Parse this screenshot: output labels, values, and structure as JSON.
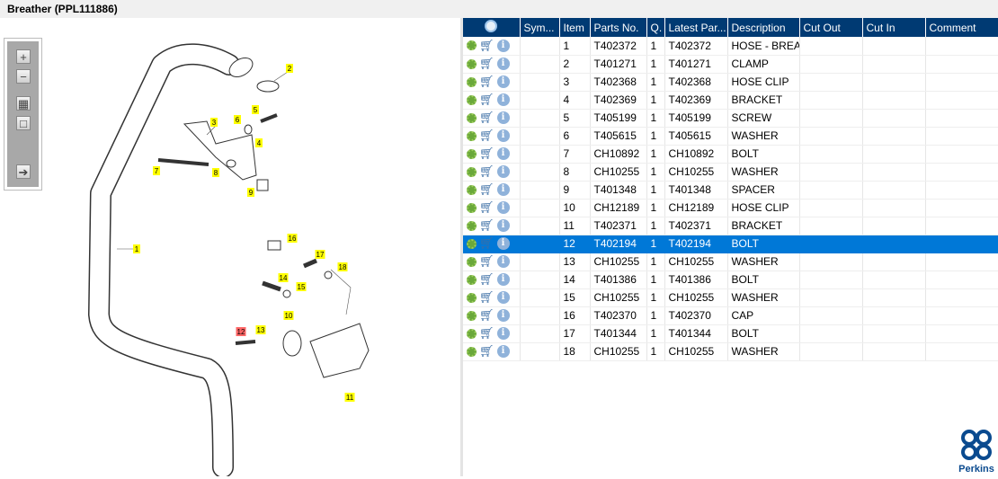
{
  "title": "Breather (PPL111886)",
  "toolbar": {
    "zoom_in": "zoom-in",
    "zoom_out": "zoom-out",
    "fit": "fit",
    "actual": "actual-size",
    "export": "export"
  },
  "diagram": {
    "callouts": [
      "1",
      "2",
      "3",
      "4",
      "5",
      "6",
      "7",
      "8",
      "9",
      "10",
      "11",
      "12",
      "13",
      "14",
      "15",
      "16",
      "17",
      "18"
    ],
    "highlighted": "12"
  },
  "table": {
    "columns": [
      "",
      "Sym...",
      "Item",
      "Parts No.",
      "Q.",
      "Latest Par...",
      "Description",
      "Cut Out",
      "Cut In",
      "Comment"
    ],
    "selected_item": "12",
    "rows": [
      {
        "item": "1",
        "part": "T402372",
        "qty": "1",
        "latest": "T402372",
        "desc": "HOSE - BREATHER"
      },
      {
        "item": "2",
        "part": "T401271",
        "qty": "1",
        "latest": "T401271",
        "desc": "CLAMP"
      },
      {
        "item": "3",
        "part": "T402368",
        "qty": "1",
        "latest": "T402368",
        "desc": "HOSE CLIP"
      },
      {
        "item": "4",
        "part": "T402369",
        "qty": "1",
        "latest": "T402369",
        "desc": "BRACKET"
      },
      {
        "item": "5",
        "part": "T405199",
        "qty": "1",
        "latest": "T405199",
        "desc": "SCREW"
      },
      {
        "item": "6",
        "part": "T405615",
        "qty": "1",
        "latest": "T405615",
        "desc": "WASHER"
      },
      {
        "item": "7",
        "part": "CH10892",
        "qty": "1",
        "latest": "CH10892",
        "desc": "BOLT"
      },
      {
        "item": "8",
        "part": "CH10255",
        "qty": "1",
        "latest": "CH10255",
        "desc": "WASHER"
      },
      {
        "item": "9",
        "part": "T401348",
        "qty": "1",
        "latest": "T401348",
        "desc": "SPACER"
      },
      {
        "item": "10",
        "part": "CH12189",
        "qty": "1",
        "latest": "CH12189",
        "desc": "HOSE CLIP"
      },
      {
        "item": "11",
        "part": "T402371",
        "qty": "1",
        "latest": "T402371",
        "desc": "BRACKET"
      },
      {
        "item": "12",
        "part": "T402194",
        "qty": "1",
        "latest": "T402194",
        "desc": "BOLT"
      },
      {
        "item": "13",
        "part": "CH10255",
        "qty": "1",
        "latest": "CH10255",
        "desc": "WASHER"
      },
      {
        "item": "14",
        "part": "T401386",
        "qty": "1",
        "latest": "T401386",
        "desc": "BOLT"
      },
      {
        "item": "15",
        "part": "CH10255",
        "qty": "1",
        "latest": "CH10255",
        "desc": "WASHER"
      },
      {
        "item": "16",
        "part": "T402370",
        "qty": "1",
        "latest": "T402370",
        "desc": "CAP"
      },
      {
        "item": "17",
        "part": "T401344",
        "qty": "1",
        "latest": "T401344",
        "desc": "BOLT"
      },
      {
        "item": "18",
        "part": "CH10255",
        "qty": "1",
        "latest": "CH10255",
        "desc": "WASHER"
      }
    ]
  },
  "logo": "Perkins",
  "colors": {
    "header": "#003a73",
    "selected": "#0078d7",
    "callout": "#ffff00",
    "callout_highlight": "#ff6666"
  }
}
